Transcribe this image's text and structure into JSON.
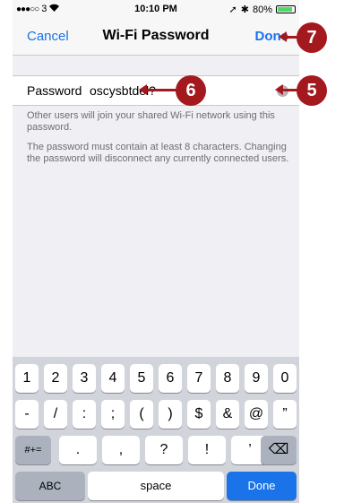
{
  "status": {
    "carrier": "3",
    "signal": "●●●○○",
    "time": "10:10 PM",
    "battery_text": "80%"
  },
  "nav": {
    "cancel": "Cancel",
    "title": "Wi-Fi Password",
    "done": "Done"
  },
  "field": {
    "label": "Password",
    "value": "oscysbtdel?",
    "clear_icon": "×"
  },
  "notes": [
    "Other users will join your shared Wi-Fi network using this password.",
    "The password must contain at least 8 characters. Changing the password will disconnect any currently connected users."
  ],
  "keyboard": {
    "row1": [
      "1",
      "2",
      "3",
      "4",
      "5",
      "6",
      "7",
      "8",
      "9",
      "0"
    ],
    "row2": [
      "-",
      "/",
      ":",
      ";",
      "(",
      ")",
      "$",
      "&",
      "@",
      "”"
    ],
    "row3_shift": "#+=",
    "row3": [
      ".",
      ",",
      "?",
      "!",
      "’"
    ],
    "backspace_icon": "⌫",
    "abc": "ABC",
    "space": "space",
    "done": "Done"
  },
  "callouts": {
    "five": "5",
    "six": "6",
    "seven": "7"
  },
  "colors": {
    "accent": "#1a73e8",
    "callout": "#a3191d"
  }
}
